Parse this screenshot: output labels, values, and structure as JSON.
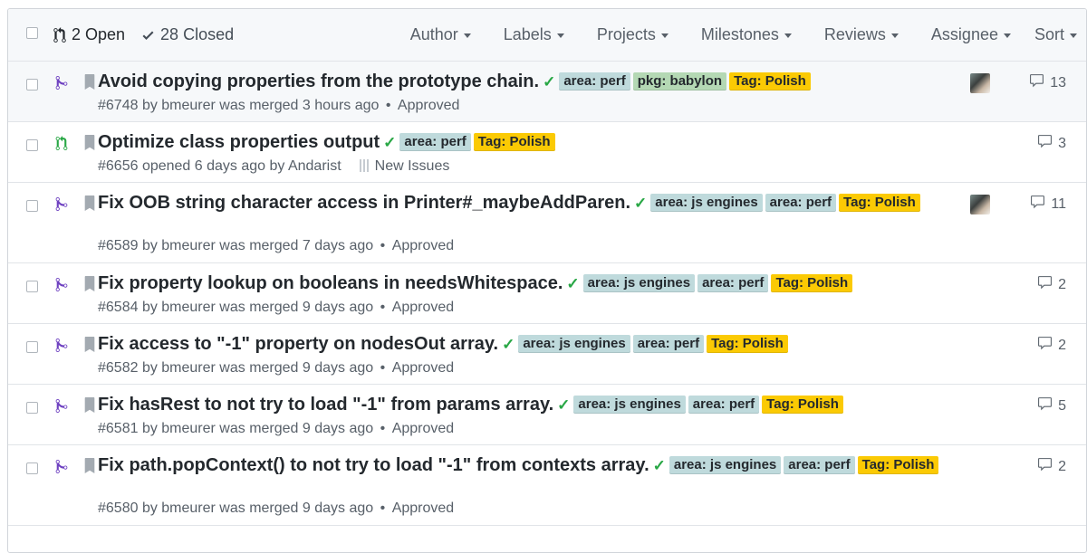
{
  "header": {
    "open_count": "2 Open",
    "closed_count": "28 Closed",
    "filters": [
      "Author",
      "Labels",
      "Projects",
      "Milestones",
      "Reviews",
      "Assignee",
      "Sort"
    ]
  },
  "colors": {
    "area_label": "#bfdadc",
    "pkg_label": "#b4d8b4",
    "polish_label": "#fbca04",
    "merged_icon": "#6f42c1",
    "open_icon": "#28a745",
    "check": "#28a745"
  },
  "prs": [
    {
      "title": "Avoid copying properties from the prototype chain.",
      "status": "merged",
      "labels": [
        "area: perf",
        "pkg: babylon",
        "Tag: Polish"
      ],
      "meta": "#6748 by bmeurer was merged 3 hours ago",
      "review": "Approved",
      "comments": "13",
      "avatar": true
    },
    {
      "title": "Optimize class properties output",
      "status": "open",
      "labels": [
        "area: perf",
        "Tag: Polish"
      ],
      "meta": "#6656 opened 6 days ago by Andarist",
      "project": "New Issues",
      "comments": "3",
      "avatar": false
    },
    {
      "title": "Fix OOB string character access in Printer#_maybeAddParen.",
      "status": "merged",
      "labels": [
        "area: js engines",
        "area: perf",
        "Tag: Polish"
      ],
      "meta": "#6589 by bmeurer was merged 7 days ago",
      "review": "Approved",
      "comments": "11",
      "avatar": true
    },
    {
      "title": "Fix property lookup on booleans in needsWhitespace.",
      "status": "merged",
      "labels": [
        "area: js engines",
        "area: perf",
        "Tag: Polish"
      ],
      "meta": "#6584 by bmeurer was merged 9 days ago",
      "review": "Approved",
      "comments": "2",
      "avatar": false
    },
    {
      "title": "Fix access to \"-1\" property on nodesOut array.",
      "status": "merged",
      "labels": [
        "area: js engines",
        "area: perf",
        "Tag: Polish"
      ],
      "meta": "#6582 by bmeurer was merged 9 days ago",
      "review": "Approved",
      "comments": "2",
      "avatar": false
    },
    {
      "title": "Fix hasRest to not try to load \"-1\" from params array.",
      "status": "merged",
      "labels": [
        "area: js engines",
        "area: perf",
        "Tag: Polish"
      ],
      "meta": "#6581 by bmeurer was merged 9 days ago",
      "review": "Approved",
      "comments": "5",
      "avatar": false
    },
    {
      "title": "Fix path.popContext() to not try to load \"-1\" from contexts array.",
      "status": "merged",
      "labels": [
        "area: js engines",
        "area: perf",
        "Tag: Polish"
      ],
      "meta": "#6580 by bmeurer was merged 9 days ago",
      "review": "Approved",
      "comments": "2",
      "avatar": false
    }
  ]
}
